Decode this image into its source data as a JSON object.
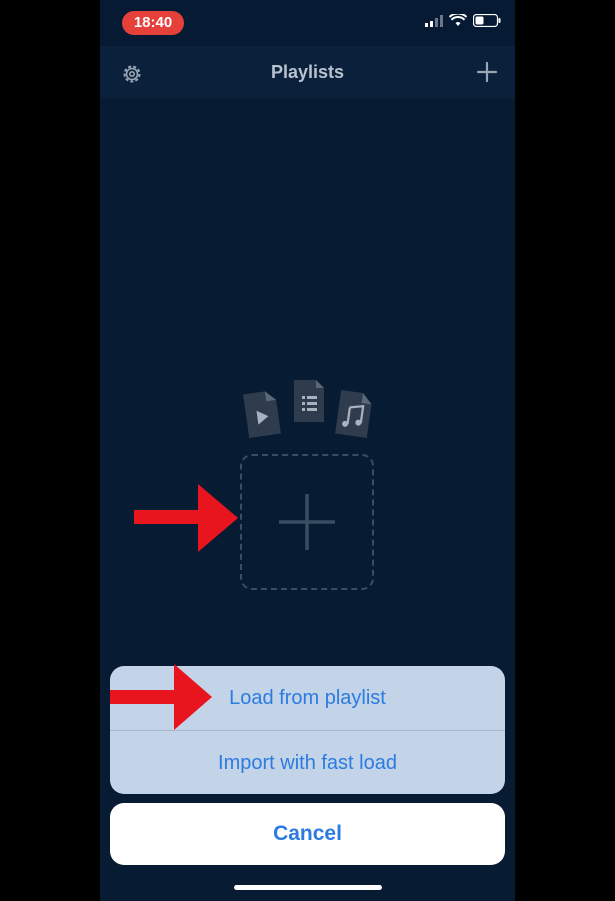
{
  "status_bar": {
    "time": "18:40"
  },
  "nav": {
    "title": "Playlists"
  },
  "empty_state": {
    "file_icons": [
      "video-file-icon",
      "list-file-icon",
      "music-file-icon"
    ],
    "add_icon": "plus-icon"
  },
  "action_sheet": {
    "items": [
      {
        "label": "Load from playlist"
      },
      {
        "label": "Import with fast load"
      }
    ],
    "cancel_label": "Cancel"
  },
  "colors": {
    "accent": "#2b7be0",
    "background": "#071b32",
    "annotation_arrow": "#e8141e",
    "time_pill": "#e5403a"
  }
}
